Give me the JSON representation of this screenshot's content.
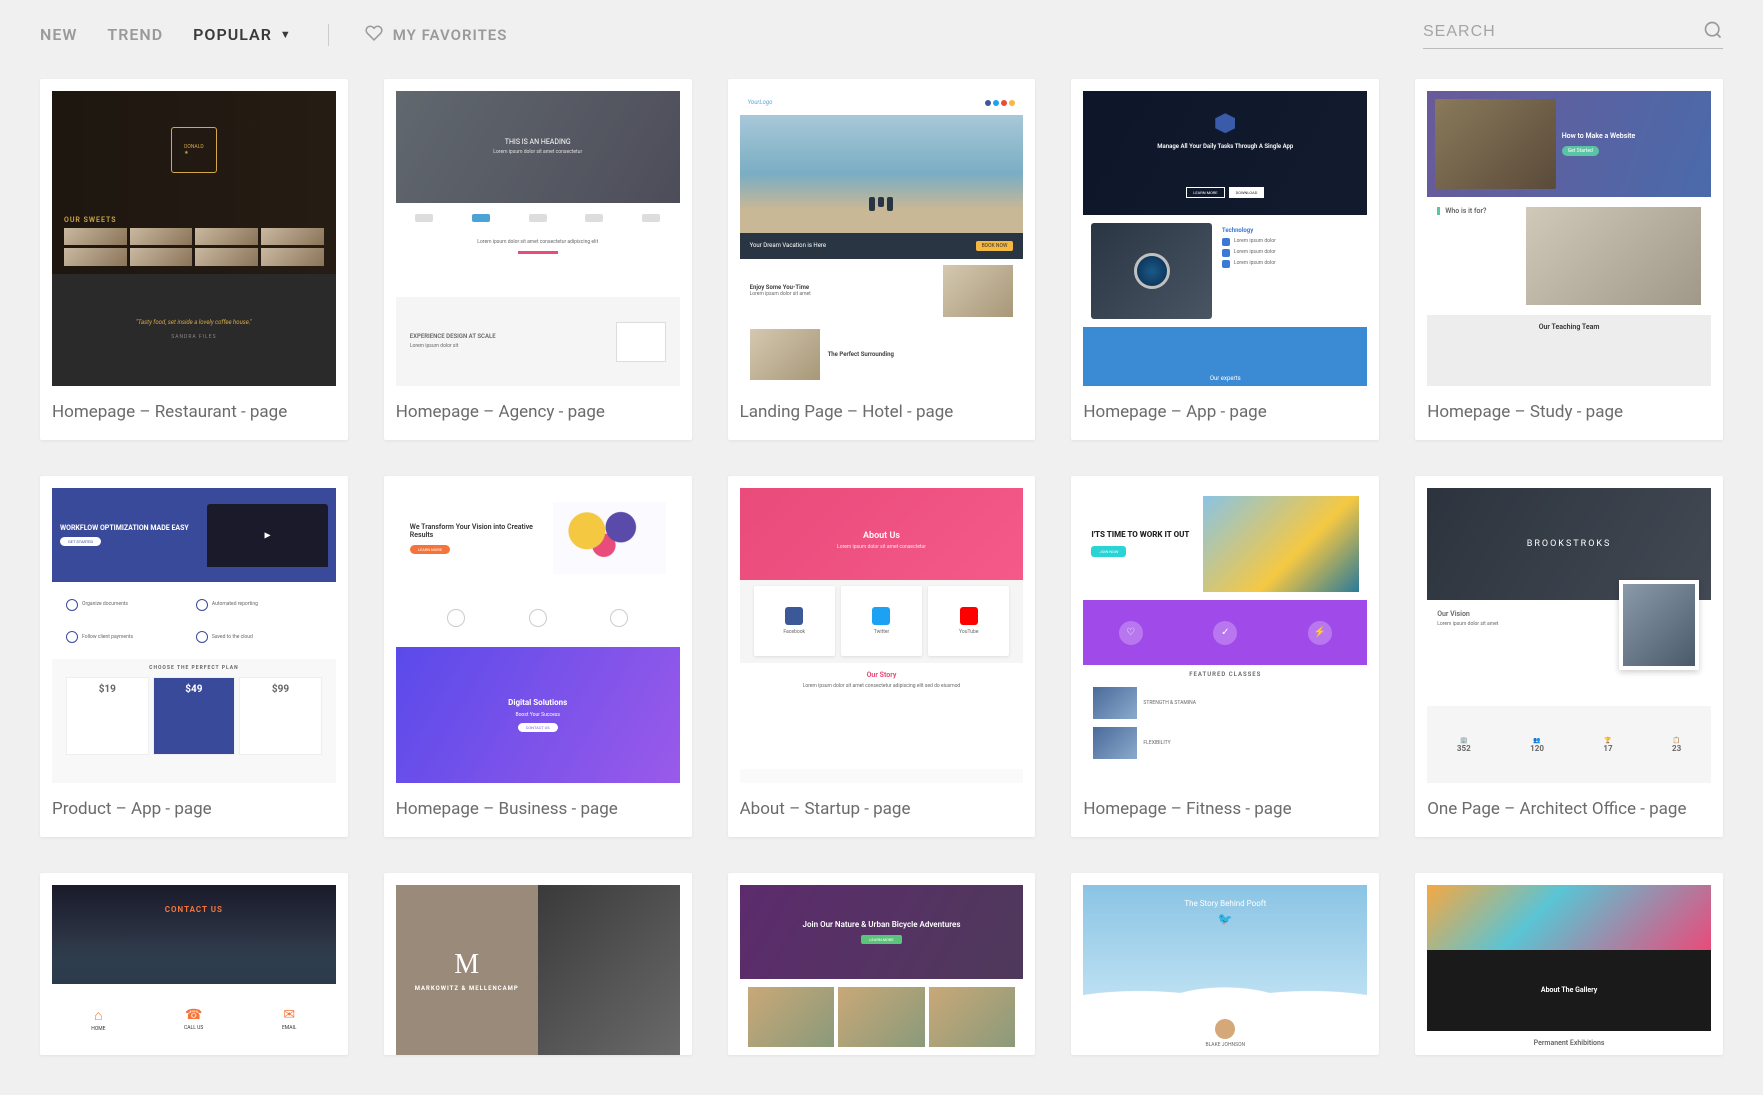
{
  "nav": {
    "tabs": [
      "NEW",
      "TREND",
      "POPULAR"
    ],
    "active_index": 2,
    "favorites_label": "MY FAVORITES"
  },
  "search": {
    "placeholder": "SEARCH"
  },
  "templates": [
    {
      "title": "Homepage – Restaurant - page",
      "thumb": {
        "section_label": "OUR SWEETS",
        "quote": "\"Tasty food, set inside a lovely coffee house.\"",
        "author": "SANDRA FILES"
      }
    },
    {
      "title": "Homepage – Agency - page",
      "thumb": {
        "hero_heading": "THIS IS AN HEADING",
        "feature_heading": "EXPERIENCE DESIGN AT SCALE"
      }
    },
    {
      "title": "Landing Page – Hotel - page",
      "thumb": {
        "logo_text": "YourLogo",
        "strip_text": "Your Dream Vacation is Here",
        "row1_title": "Enjoy Some You-Time",
        "row2_title": "The Perfect Surrounding"
      }
    },
    {
      "title": "Homepage – App - page",
      "thumb": {
        "hero_text": "Manage All Your Daily Tasks Through A Single App",
        "btn1": "LEARN MORE",
        "btn2": "DOWNLOAD",
        "tech_label": "Technology",
        "footer_label": "Our experts"
      }
    },
    {
      "title": "Homepage – Study - page",
      "thumb": {
        "hero_heading": "How to Make a Website",
        "hero_cta": "Get Started",
        "who_heading": "Who is it for?",
        "team_heading": "Our Teaching Team"
      }
    },
    {
      "title": "Product – App - page",
      "thumb": {
        "hero_heading": "WORKFLOW OPTIMIZATION MADE EASY",
        "plans_heading": "CHOOSE THE PERFECT PLAN",
        "prices": [
          "$19",
          "$49",
          "$99"
        ]
      }
    },
    {
      "title": "Homepage – Business - page",
      "thumb": {
        "hero_heading": "We Transform Your Vision into Creative Results",
        "grad_heading": "Digital Solutions",
        "grad_sub": "Boost Your Success"
      }
    },
    {
      "title": "About – Startup - page",
      "thumb": {
        "hero_heading": "About Us",
        "social": [
          "Facebook",
          "Twitter",
          "YouTube"
        ],
        "story_heading": "Our Story"
      }
    },
    {
      "title": "Homepage – Fitness - page",
      "thumb": {
        "hero_heading": "I'TS TIME TO WORK IT OUT",
        "classes_heading": "FEATURED CLASSES",
        "class1": "STRENGTH & STAMINA"
      }
    },
    {
      "title": "One Page – Architect Office - page",
      "thumb": {
        "hero_heading": "BROOKSTROKS",
        "vision_heading": "Our Vision",
        "stats": [
          {
            "icon": "🏢",
            "value": "352"
          },
          {
            "icon": "👥",
            "value": "120"
          },
          {
            "icon": "🏆",
            "value": "17"
          },
          {
            "icon": "📋",
            "value": "23"
          }
        ]
      }
    },
    {
      "title": "",
      "thumb": {
        "heading": "CONTACT US",
        "items": [
          "HOME",
          "CALL US",
          "EMAIL"
        ]
      }
    },
    {
      "title": "",
      "thumb": {
        "letter": "M",
        "name": "MARKOWITZ & MELLENCAMP"
      }
    },
    {
      "title": "",
      "thumb": {
        "heading": "Join Our Nature & Urban Bicycle Adventures"
      }
    },
    {
      "title": "",
      "thumb": {
        "heading": "The Story Behind Pooft",
        "author": "BLAKE JOHNSON"
      }
    },
    {
      "title": "",
      "thumb": {
        "heading": "About The Gallery",
        "footer": "Permanent Exhibitions"
      }
    }
  ]
}
